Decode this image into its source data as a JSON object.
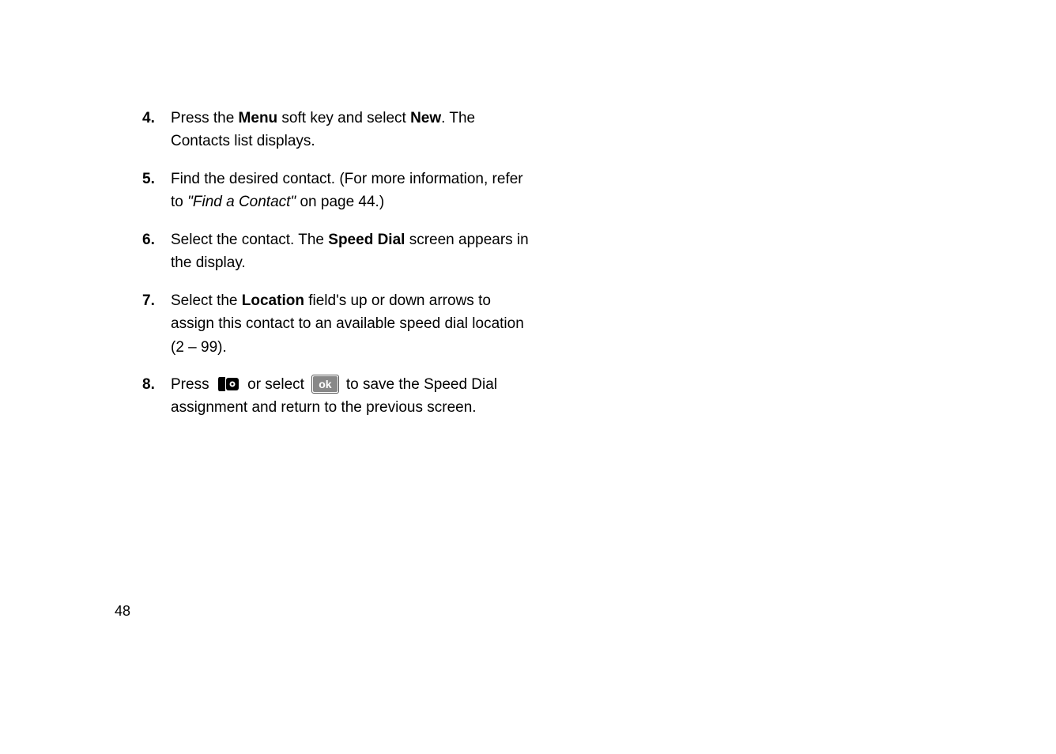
{
  "page_number": "48",
  "steps": [
    {
      "num": "4.",
      "parts": [
        {
          "t": "Press the ",
          "b": false
        },
        {
          "t": "Menu",
          "b": true
        },
        {
          "t": " soft key and select ",
          "b": false
        },
        {
          "t": "New",
          "b": true
        },
        {
          "t": ". The Contacts list displays.",
          "b": false
        }
      ]
    },
    {
      "num": "5.",
      "parts": [
        {
          "t": "Find the desired contact. (For more information, refer to ",
          "b": false
        },
        {
          "t": "\"Find a Contact\"",
          "i": true
        },
        {
          "t": "  on page 44.)",
          "b": false
        }
      ]
    },
    {
      "num": "6.",
      "parts": [
        {
          "t": "Select the contact. The ",
          "b": false
        },
        {
          "t": "Speed Dial",
          "b": true
        },
        {
          "t": " screen appears in the display.",
          "b": false
        }
      ]
    },
    {
      "num": "7.",
      "parts": [
        {
          "t": "Select the ",
          "b": false
        },
        {
          "t": "Location",
          "b": true
        },
        {
          "t": " field's up or down arrows to assign this contact to an available speed dial location (2 – 99).",
          "b": false
        }
      ]
    },
    {
      "num": "8.",
      "parts": [
        {
          "t": "Press ",
          "b": false
        },
        {
          "icon": "center-select"
        },
        {
          "t": " or select ",
          "b": false
        },
        {
          "icon": "ok"
        },
        {
          "t": " to save the Speed Dial assignment and return to the previous screen.",
          "b": false
        }
      ]
    }
  ],
  "ok_label": "ok"
}
